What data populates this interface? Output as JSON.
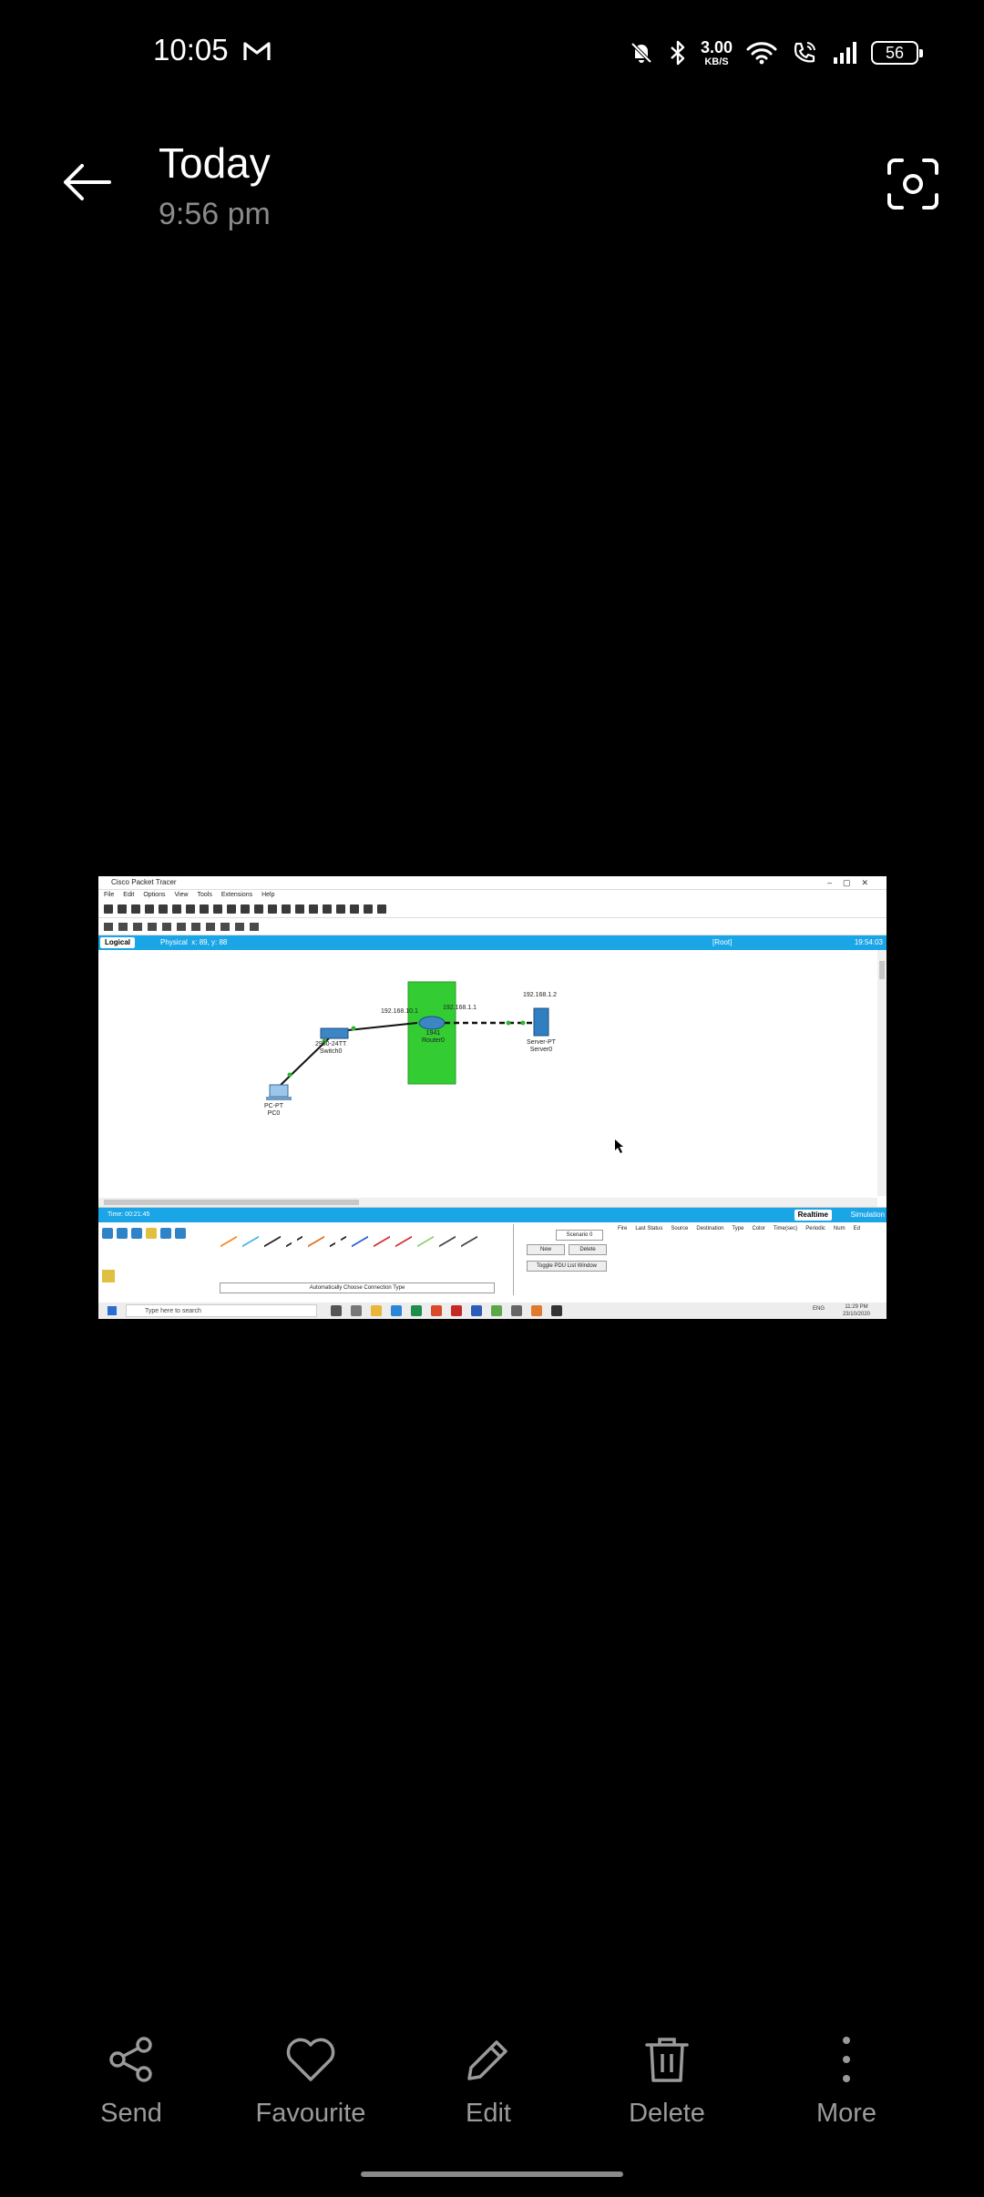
{
  "status_bar": {
    "time": "10:05",
    "net_speed_value": "3.00",
    "net_speed_unit": "KB/S",
    "battery": "56",
    "icons": [
      "gmail-icon",
      "mute-bell-icon",
      "bluetooth-icon",
      "wifi-icon",
      "wifi-call-icon",
      "signal-icon",
      "battery-icon"
    ]
  },
  "header": {
    "title": "Today",
    "subtitle": "9:56 pm"
  },
  "photo": {
    "app_title": "Cisco Packet Tracer",
    "menu": [
      "File",
      "Edit",
      "Options",
      "View",
      "Tools",
      "Extensions",
      "Help"
    ],
    "tab_logical": "Logical",
    "tab_physical": "Physical",
    "coords": "x: 89, y: 88",
    "root": "[Root]",
    "canvas_time": "19:54:03",
    "nodes": {
      "pc": {
        "type": "PC-PT",
        "name": "PC0"
      },
      "switch": {
        "type": "2960-24TT",
        "name": "Switch0"
      },
      "router": {
        "type": "1941",
        "name": "Router0"
      },
      "server": {
        "type": "Server-PT",
        "name": "Server0"
      },
      "ip_router_left": "192.168.10.1",
      "ip_router_right": "192.168.1.1",
      "ip_server": "192.168.1.2"
    },
    "sim_time": "Time: 00:21:45",
    "realtime": "Realtime",
    "simulation": "Simulation",
    "connection_label": "Automatically Choose Connection Type",
    "scenario": "Scenario 0",
    "new_btn": "New",
    "delete_btn": "Delete",
    "toggle_pdu": "Toggle PDU List Window",
    "pdu_columns": [
      "Fire",
      "Last Status",
      "Source",
      "Destination",
      "Type",
      "Color",
      "Time(sec)",
      "Periodic",
      "Num",
      "Ed"
    ],
    "taskbar_search": "Type here to search",
    "taskbar_lang": "ENG",
    "taskbar_time": "11:29 PM",
    "taskbar_date": "23/10/2020"
  },
  "actions": [
    {
      "label": "Send",
      "icon": "share-icon"
    },
    {
      "label": "Favourite",
      "icon": "heart-icon"
    },
    {
      "label": "Edit",
      "icon": "pencil-icon"
    },
    {
      "label": "Delete",
      "icon": "trash-icon"
    },
    {
      "label": "More",
      "icon": "more-vertical-icon"
    }
  ],
  "colors": {
    "background": "#000000",
    "packet_tracer_blue": "#1aa5e6",
    "router_area_green": "#33cc33",
    "label_gray": "#9a9a9a"
  }
}
